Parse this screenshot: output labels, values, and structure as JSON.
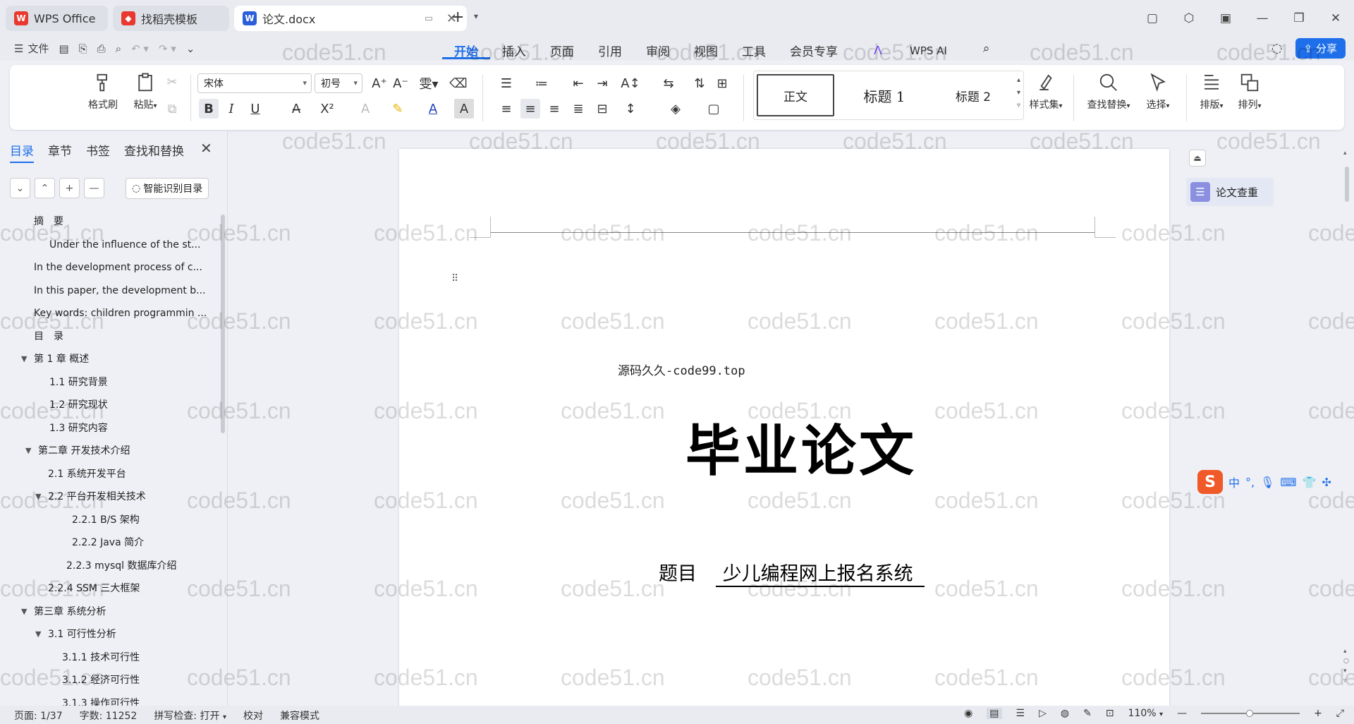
{
  "tabs": {
    "wps": "WPS Office",
    "template": "找稻壳模板",
    "doc": "论文.docx"
  },
  "menu": {
    "file": "文件",
    "tabs": [
      "开始",
      "插入",
      "页面",
      "引用",
      "审阅",
      "视图",
      "工具",
      "会员专享"
    ],
    "active_tab": "开始",
    "wps_ai": "WPS AI",
    "share": "分享"
  },
  "ribbon": {
    "format_painter": "格式刷",
    "paste": "粘贴",
    "font": "宋体",
    "size": "初号",
    "styles": [
      "正文",
      "标题 1",
      "标题 2"
    ],
    "style_set": "样式集",
    "find_replace": "查找替换",
    "select": "选择",
    "layout": "排版",
    "arrange": "排列"
  },
  "nav": {
    "tabs": [
      "目录",
      "章节",
      "书签",
      "查找和替换"
    ],
    "active": "目录",
    "smart_btn": "智能识别目录",
    "toc": [
      {
        "t": "摘　要",
        "lvl": 1
      },
      {
        "t": "Under the influence of the st...",
        "lvl": 2
      },
      {
        "t": "In the development process of c...",
        "lvl": 1
      },
      {
        "t": "In this paper, the development b...",
        "lvl": 1
      },
      {
        "t": "Key words: children programmin ...",
        "lvl": 1
      },
      {
        "t": "目　录",
        "lvl": 1
      },
      {
        "t": "第 1 章  概述",
        "lvl": 1,
        "tri": true
      },
      {
        "t": "1.1  研究背景",
        "lvl": 2
      },
      {
        "t": "1.2  研究现状",
        "lvl": 2
      },
      {
        "t": "1.3  研究内容",
        "lvl": 2
      },
      {
        "t": "第二章  开发技术介绍",
        "lvl": 1,
        "tri": true
      },
      {
        "t": "2.1    系统开发平台",
        "lvl": 2
      },
      {
        "t": "2.2  平台开发相关技术",
        "lvl": 2,
        "tri": true
      },
      {
        "t": "2.2.1    B/S 架构",
        "lvl": 3
      },
      {
        "t": "2.2.2    Java 简介",
        "lvl": 3
      },
      {
        "t": "2.2.3 mysql 数据库介绍",
        "lvl": 3
      },
      {
        "t": "2.2.4 SSM 三大框架",
        "lvl": 2
      },
      {
        "t": "第三章  系统分析",
        "lvl": 1,
        "tri": true
      },
      {
        "t": "3.1  可行性分析",
        "lvl": 2,
        "tri": true
      },
      {
        "t": "3.1.1    技术可行性",
        "lvl": 3
      },
      {
        "t": "3.1.2  经济可行性",
        "lvl": 3
      },
      {
        "t": "3.1.3  操作可行性",
        "lvl": 3
      }
    ]
  },
  "document": {
    "source": "源码久久-code99.top",
    "title": "毕业论文",
    "subject_label": "题目",
    "subject_value": "少儿编程网上报名系统"
  },
  "right_panel": {
    "paper_check": "论文查重"
  },
  "ime": {
    "lang": "中"
  },
  "status": {
    "page": "页面: 1/37",
    "words": "字数: 11252",
    "spell": "拼写检查: 打开",
    "proof": "校对",
    "compat": "兼容模式",
    "zoom": "110%"
  },
  "watermark": "code51.cn",
  "colors": {
    "accent": "#1f6feb",
    "wps_red": "#e8382f"
  }
}
